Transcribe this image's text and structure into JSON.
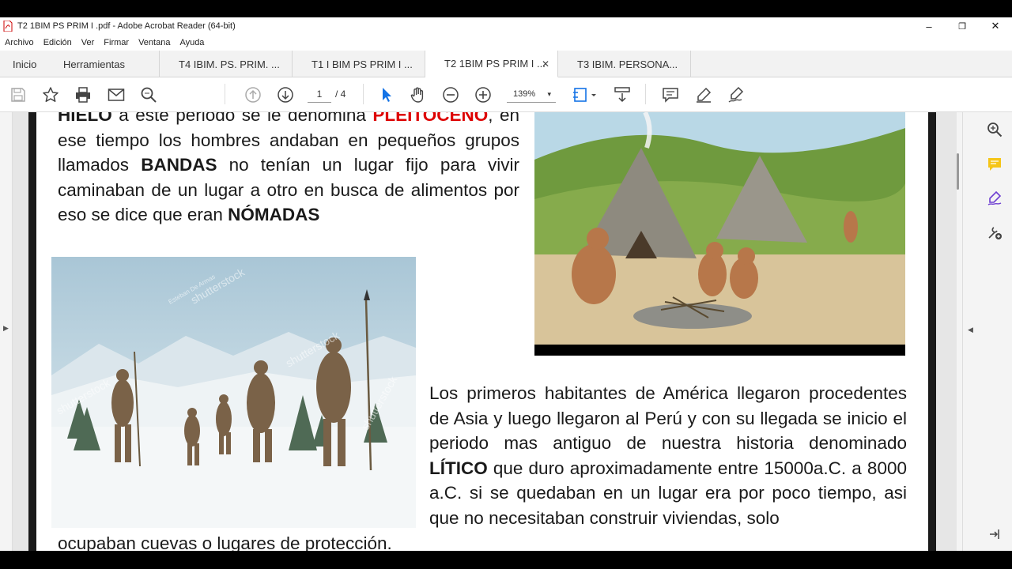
{
  "window": {
    "title": "T2 1BIM PS PRIM I .pdf - Adobe Acrobat Reader (64-bit)",
    "controls": {
      "minimize": "–",
      "maximize": "❐",
      "close": "✕"
    }
  },
  "menubar": [
    "Archivo",
    "Edición",
    "Ver",
    "Firmar",
    "Ventana",
    "Ayuda"
  ],
  "tabs": {
    "home": "Inicio",
    "tools": "Herramientas",
    "docs": [
      {
        "label": "T4 IBIM. PS. PRIM. ...",
        "active": false
      },
      {
        "label": "T1 I BIM PS PRIM I ...",
        "active": false
      },
      {
        "label": "T2 1BIM PS PRIM I ...",
        "active": true
      },
      {
        "label": "T3 IBIM. PERSONA...",
        "active": false
      }
    ],
    "close_glyph": "✕"
  },
  "toolbar": {
    "page_current": "1",
    "page_total": "/ 4",
    "zoom": "139%",
    "caret": "▾"
  },
  "document": {
    "p1": {
      "t1": "HIELO",
      "t2": " a este periodo se le denomina ",
      "t3": "PLEITOCENO",
      "t4": ", en ese tiempo los hombres andaban en pequeños grupos llamados ",
      "t5": "BANDAS",
      "t6": " no tenían un lugar fijo para vivir caminaban de un lugar a otro en busca de alimentos por eso se dice que eran ",
      "t7": "NÓMADAS"
    },
    "p2": {
      "t1": "Los primeros habitantes de América llegaron procedentes de Asia y luego llegaron al Perú y con su llegada se inicio el periodo mas antiguo de nuestra historia denominado ",
      "t2": "LÍTICO",
      "t3": " que duro aproximadamente entre 15000a.C. a 8000 a.C. si se quedaban en un lugar era por poco tiempo, asi que no necesitaban construir viviendas, solo"
    },
    "p3": "ocupaban cuevas o lugares de protección.",
    "image1_watermark": "shutterstock",
    "image1_credit": "Esteban De Armas"
  },
  "colors": {
    "accent_red": "#d00000",
    "acrobat_blue": "#1473e6",
    "comment_yellow": "#f5c518",
    "edit_purple": "#6e3fd1"
  }
}
